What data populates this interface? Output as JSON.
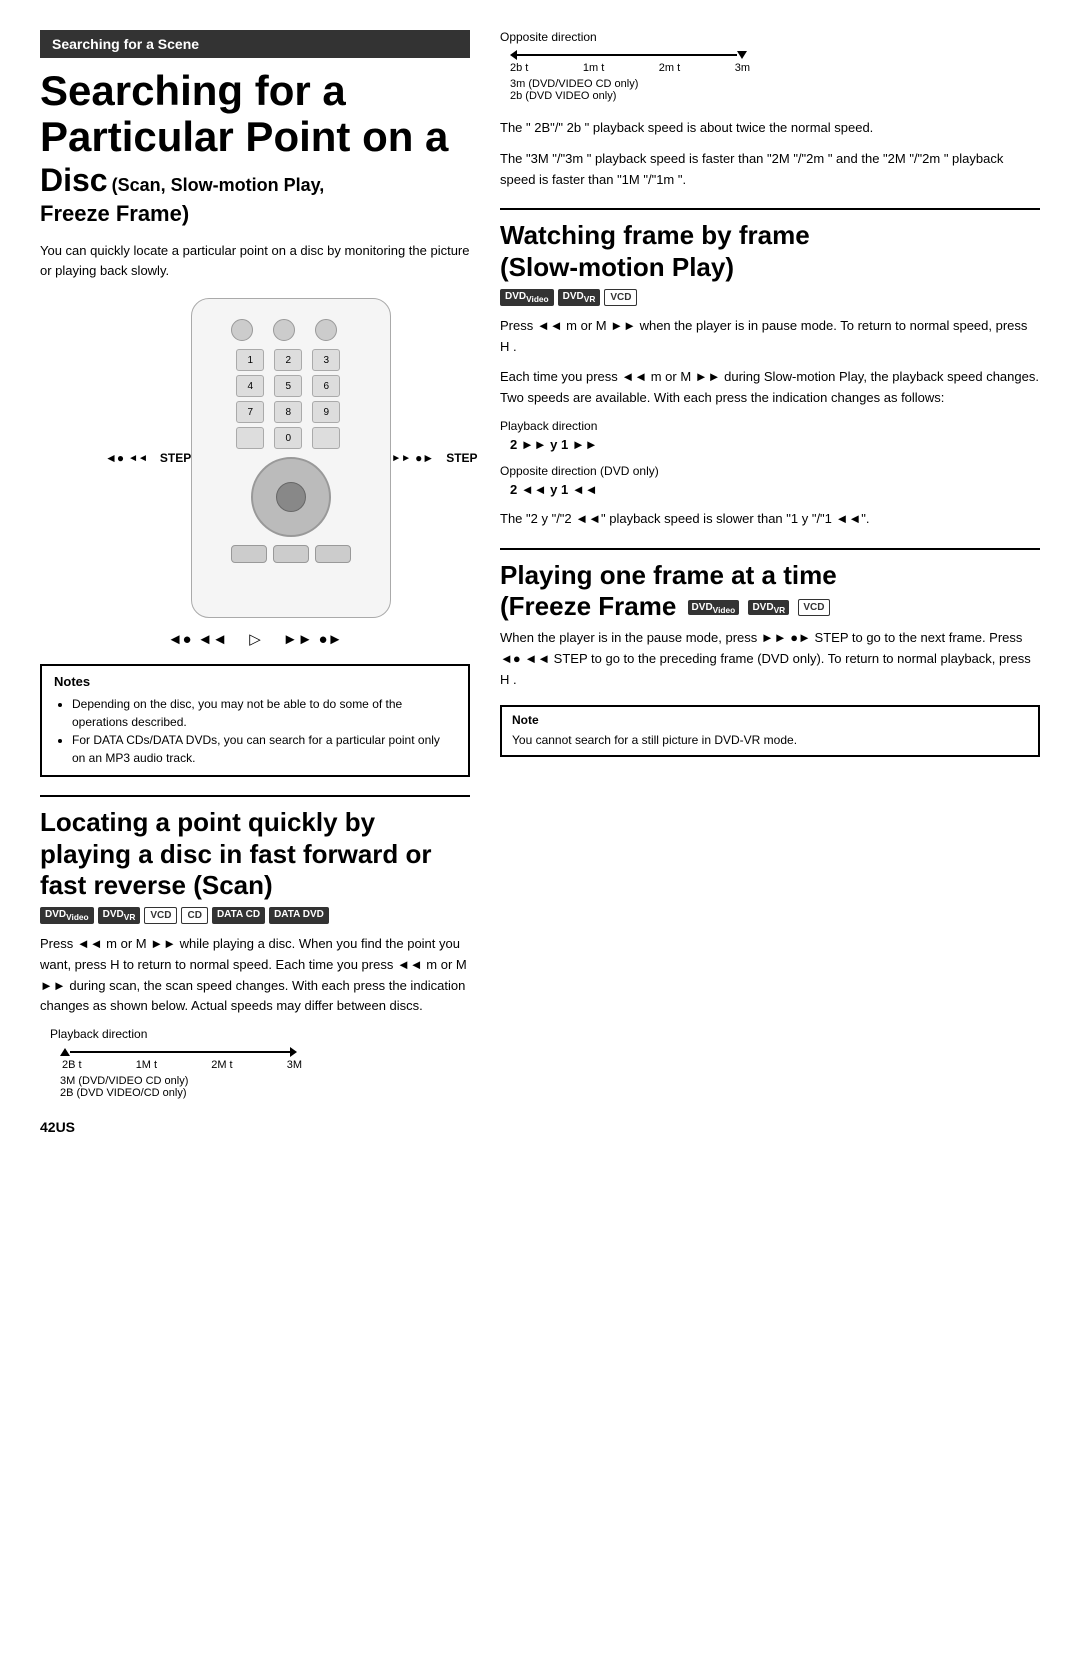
{
  "banner": "Searching for a Scene",
  "mainTitle": "Searching for a",
  "mainTitle2": "Particular Point on a",
  "discSubtitle": "Disc",
  "discSubtitleSmall": "(Scan, Slow-motion Play,",
  "freezeSub": "Freeze Frame)",
  "introText": "You can quickly locate a particular point on a disc by monitoring the picture or playing back slowly.",
  "notes": {
    "header": "Notes",
    "items": [
      "Depending on the disc, you may not be able to do some of the operations described.",
      "For DATA CDs/DATA DVDs, you can search for a particular point only on an MP3 audio track."
    ]
  },
  "scanSection": {
    "heading1": "Locating a point quickly by",
    "heading2": "playing a disc in fast forward or",
    "heading3": "fast reverse (Scan)",
    "badges": [
      "DVDVideo",
      "DVDVR",
      "VCD",
      "CD",
      "DATA CD",
      "DATA DVD"
    ],
    "body1": "Press ◄◄ m   or M  ►► while playing a disc. When you find the point you want, press H   to return to normal speed. Each time you press ◄◄ m   or M  ►► during scan, the scan speed changes. With each press the indication changes as shown below. Actual speeds may differ between discs.",
    "playbackDirLabel": "Playback direction",
    "scanTicks": [
      "2B t",
      "1M t",
      "2M t",
      "3M"
    ],
    "scanCaption1": "3M   (DVD/VIDEO CD only)",
    "scanCaption2": "2B (DVD VIDEO/CD only)"
  },
  "rightTopSection": {
    "oppDirLabel": "Opposite direction",
    "oppTicks": [
      "2b t",
      "1m t",
      "2m t",
      "3m"
    ],
    "oppCaption1": "3m   (DVD/VIDEO CD only)",
    "oppCaption2": "2b (DVD VIDEO only)",
    "body1": "The \" 2B\"/\" 2b \" playback speed is about twice the normal speed.",
    "body2": "The \"3M \"/\"3m \" playback speed is faster than \"2M \"/\"2m \" and the \"2M \"/\"2m \" playback speed is faster than \"1M  \"/\"1m  \"."
  },
  "slowMotionSection": {
    "heading1": "Watching frame by frame",
    "heading2": "(Slow-motion Play)",
    "badges": [
      "DVDVideo",
      "DVDVR",
      "VCD"
    ],
    "body1": "Press ◄◄ m   or M  ►► when the player is in pause mode. To return to normal speed, press H  .",
    "body2": "Each time you press ◄◄ m   or M  ►► during Slow-motion Play, the playback speed changes. Two speeds are available. With each press the indication changes as follows:",
    "playbackDirLabel": "Playback direction",
    "fwdSpeed": "2 ►► y   1 ►►",
    "oppDirLabel": "Opposite direction (DVD only)",
    "revSpeed": "2 ◄◄ y   1 ◄◄",
    "body3": "The \"2 y \"/\"2 ◄◄\" playback speed is slower than \"1 y \"/\"1 ◄◄\"."
  },
  "freezeSection": {
    "heading1": "Playing one frame at a time",
    "heading2": "(Freeze Frame",
    "badges": [
      "DVDVideo",
      "DVDVR",
      "VCD"
    ],
    "body1": "When the player is in the pause mode, press ►► ●► STEP to go to the next frame. Press ◄● ◄◄ STEP to go to the preceding frame (DVD only). To return to normal playback, press H  .",
    "note": {
      "header": "Note",
      "text": "You cannot search for a still picture in DVD-VR mode."
    }
  },
  "pageNumber": "42US"
}
